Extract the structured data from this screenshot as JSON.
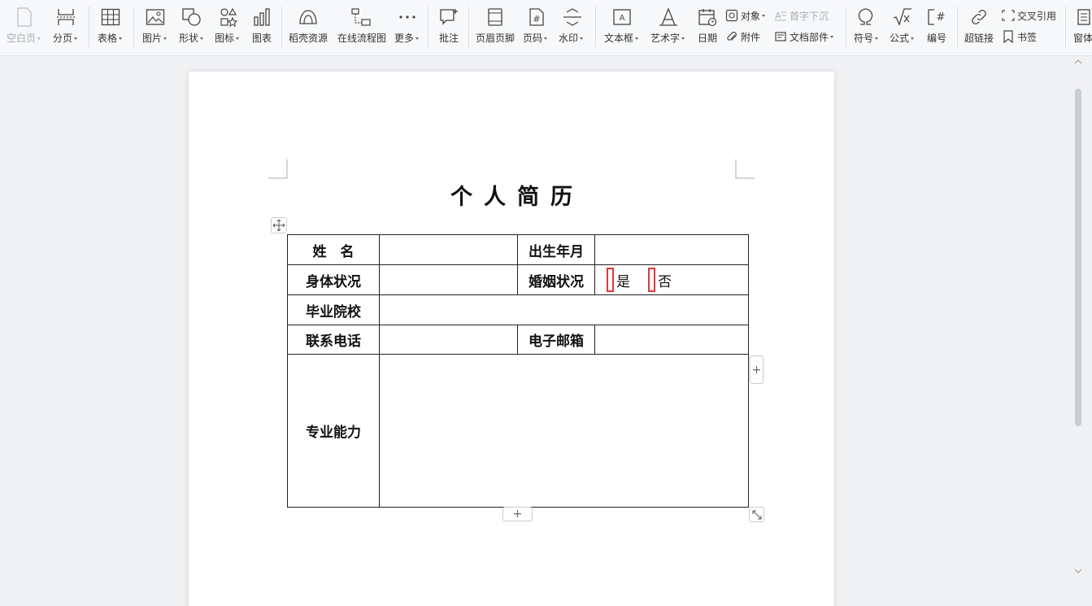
{
  "ribbon": {
    "blank_page": "空白页",
    "page_break": "分页",
    "table": "表格",
    "picture": "图片",
    "shape": "形状",
    "icons": "图标",
    "chart": "图表",
    "resources": "稻壳资源",
    "flowchart": "在线流程图",
    "more": "更多",
    "comment": "批注",
    "header_footer": "页眉页脚",
    "page_number": "页码",
    "watermark": "水印",
    "textbox": "文本框",
    "wordart": "艺术字",
    "date": "日期",
    "object": "对象",
    "drop_cap": "首字下沉",
    "attachment": "附件",
    "doc_parts": "文档部件",
    "symbol": "符号",
    "formula": "公式",
    "numbering": "编号",
    "hyperlink": "超链接",
    "cross_reference": "交叉引用",
    "bookmark": "书签",
    "window": "窗体"
  },
  "document": {
    "title": "个人简历",
    "table": {
      "name": "姓　名",
      "birth": "出生年月",
      "health": "身体状况",
      "marital": "婚姻状况",
      "yes": "是",
      "no": "否",
      "school": "毕业院校",
      "phone": "联系电话",
      "email": "电子邮箱",
      "skills": "专业能力"
    }
  },
  "controls": {
    "add_col": "+",
    "add_row": "+"
  },
  "colors": {
    "checkbox_border": "#e0393b"
  }
}
